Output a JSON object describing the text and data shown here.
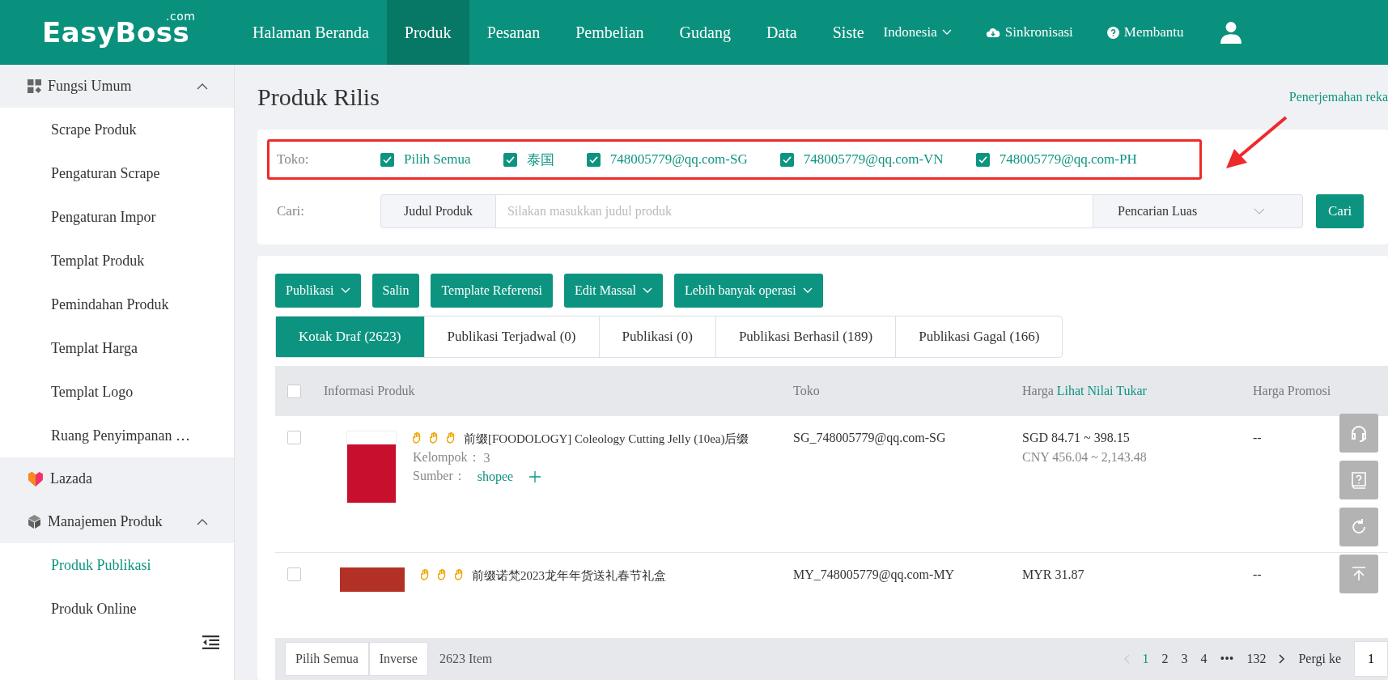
{
  "header": {
    "logo": "EasyBoss",
    "logo_sup": ".com",
    "nav": [
      {
        "label": "Halaman Beranda",
        "selected": false
      },
      {
        "label": "Produk",
        "selected": true
      },
      {
        "label": "Pesanan",
        "selected": false
      },
      {
        "label": "Pembelian",
        "selected": false
      },
      {
        "label": "Gudang",
        "selected": false
      },
      {
        "label": "Data",
        "selected": false
      },
      {
        "label": "Siste",
        "selected": false
      }
    ],
    "language": "Indonesia",
    "sync": "Sinkronisasi",
    "help": "Membantu"
  },
  "sidebar": {
    "groups": [
      {
        "label": "Fungsi Umum",
        "kind": "grid",
        "expanded": true,
        "children": [
          {
            "label": "Scrape Produk",
            "selected": false
          },
          {
            "label": "Pengaturan Scrape",
            "selected": false
          },
          {
            "label": "Pengaturan Impor",
            "selected": false
          },
          {
            "label": "Templat Produk",
            "selected": false
          },
          {
            "label": "Pemindahan Produk",
            "selected": false
          },
          {
            "label": "Templat Harga",
            "selected": false
          },
          {
            "label": "Templat Logo",
            "selected": false
          },
          {
            "label": "Ruang Penyimpanan …",
            "selected": false
          }
        ]
      },
      {
        "label": "Lazada",
        "kind": "heart",
        "expanded": false
      },
      {
        "label": "Manajemen Produk",
        "kind": "box",
        "expanded": true,
        "children": [
          {
            "label": "Produk Publikasi",
            "selected": true
          },
          {
            "label": "Produk Online",
            "selected": false
          }
        ]
      }
    ]
  },
  "page": {
    "title": "Produk Rilis",
    "link": "Penerjemahan reka"
  },
  "filter": {
    "shop_label": "Toko:",
    "shops": [
      {
        "label": "Pilih Semua",
        "checked": true
      },
      {
        "label": "泰国",
        "checked": true
      },
      {
        "label": "748005779@qq.com-SG",
        "checked": true
      },
      {
        "label": "748005779@qq.com-VN",
        "checked": true
      },
      {
        "label": "748005779@qq.com-PH",
        "checked": true
      }
    ],
    "search_label": "Cari:",
    "search_type": "Judul Produk",
    "placeholder": "Silakan masukkan judul produk",
    "mode": "Pencarian Luas",
    "button": "Cari"
  },
  "actions": [
    {
      "label": "Publikasi",
      "dropdown": true
    },
    {
      "label": "Salin",
      "dropdown": false
    },
    {
      "label": "Template Referensi",
      "dropdown": false
    },
    {
      "label": "Edit Massal",
      "dropdown": true
    },
    {
      "label": "Lebih banyak operasi",
      "dropdown": true
    }
  ],
  "tabs": [
    {
      "label": "Kotak Draf (2623)",
      "selected": true
    },
    {
      "label": "Publikasi Terjadwal (0)",
      "selected": false
    },
    {
      "label": "Publikasi (0)",
      "selected": false
    },
    {
      "label": "Publikasi Berhasil (189)",
      "selected": false
    },
    {
      "label": "Publikasi Gagal (166)",
      "selected": false
    }
  ],
  "table": {
    "select_all_checked": false,
    "columns": [
      "Informasi Produk",
      "Toko",
      "Harga",
      "Harga Promosi"
    ],
    "price_link": "Lihat Nilai Tukar",
    "rows": [
      {
        "checked": false,
        "title": "前缀[FOODOLOGY] Coleology Cutting Jelly (10ea)后缀",
        "group_label": "Kelompok：",
        "group": "3",
        "source_label": "Sumber：",
        "source": "shopee",
        "shop": "SG_748005779@qq.com-SG",
        "price": "SGD 84.71 ~ 398.15",
        "price_cny": "CNY 456.04 ~ 2,143.48",
        "promo": "--"
      },
      {
        "checked": false,
        "title": "前缀诺梵2023龙年年货送礼春节礼盒",
        "shop": "MY_748005779@qq.com-MY",
        "price": "MYR 31.87",
        "promo": "--"
      }
    ]
  },
  "footer": {
    "select_all": "Pilih Semua",
    "inverse": "Inverse",
    "count": "2623 Item",
    "pages": [
      {
        "label": "1",
        "selected": true
      },
      {
        "label": "2",
        "selected": false
      },
      {
        "label": "3",
        "selected": false
      },
      {
        "label": "4",
        "selected": false
      },
      {
        "label": "•••",
        "selected": false
      },
      {
        "label": "132",
        "selected": false
      }
    ],
    "goto": "Pergi ke",
    "goto_value": "1"
  }
}
